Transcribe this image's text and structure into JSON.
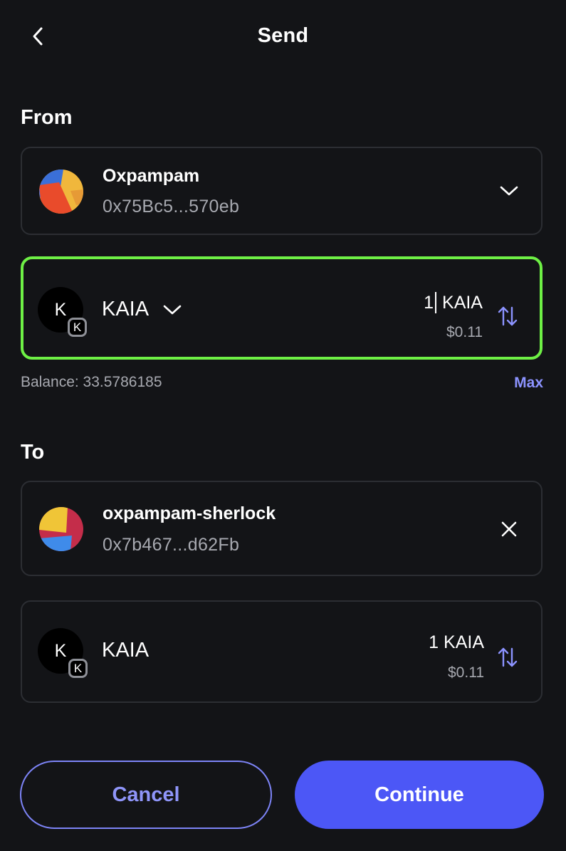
{
  "header": {
    "title": "Send",
    "back_icon": "chevron-left-icon"
  },
  "from": {
    "label": "From",
    "account": {
      "name": "Oxpampam",
      "address": "0x75Bc5...570eb",
      "dropdown_icon": "chevron-down-icon"
    },
    "token": {
      "logo_letter": "K",
      "badge_letter": "K",
      "symbol": "KAIA",
      "amount_value": "1",
      "amount_unit": "KAIA",
      "usd_value": "$0.11",
      "swap_icon": "swap-arrows-icon"
    },
    "balance": "Balance: 33.5786185",
    "max_label": "Max"
  },
  "to": {
    "label": "To",
    "account": {
      "name": "oxpampam-sherlock",
      "address": "0x7b467...d62Fb",
      "clear_icon": "close-icon"
    },
    "token": {
      "logo_letter": "K",
      "badge_letter": "K",
      "symbol": "KAIA",
      "amount": "1 KAIA",
      "usd_value": "$0.11",
      "swap_icon": "swap-arrows-icon"
    }
  },
  "actions": {
    "cancel_label": "Cancel",
    "continue_label": "Continue"
  },
  "colors": {
    "background": "#131417",
    "card_border": "#2c2e33",
    "focus_border": "#6ef045",
    "accent": "#4c57f6",
    "accent_text": "#8c93ff",
    "secondary_text": "#a7a9b0"
  }
}
